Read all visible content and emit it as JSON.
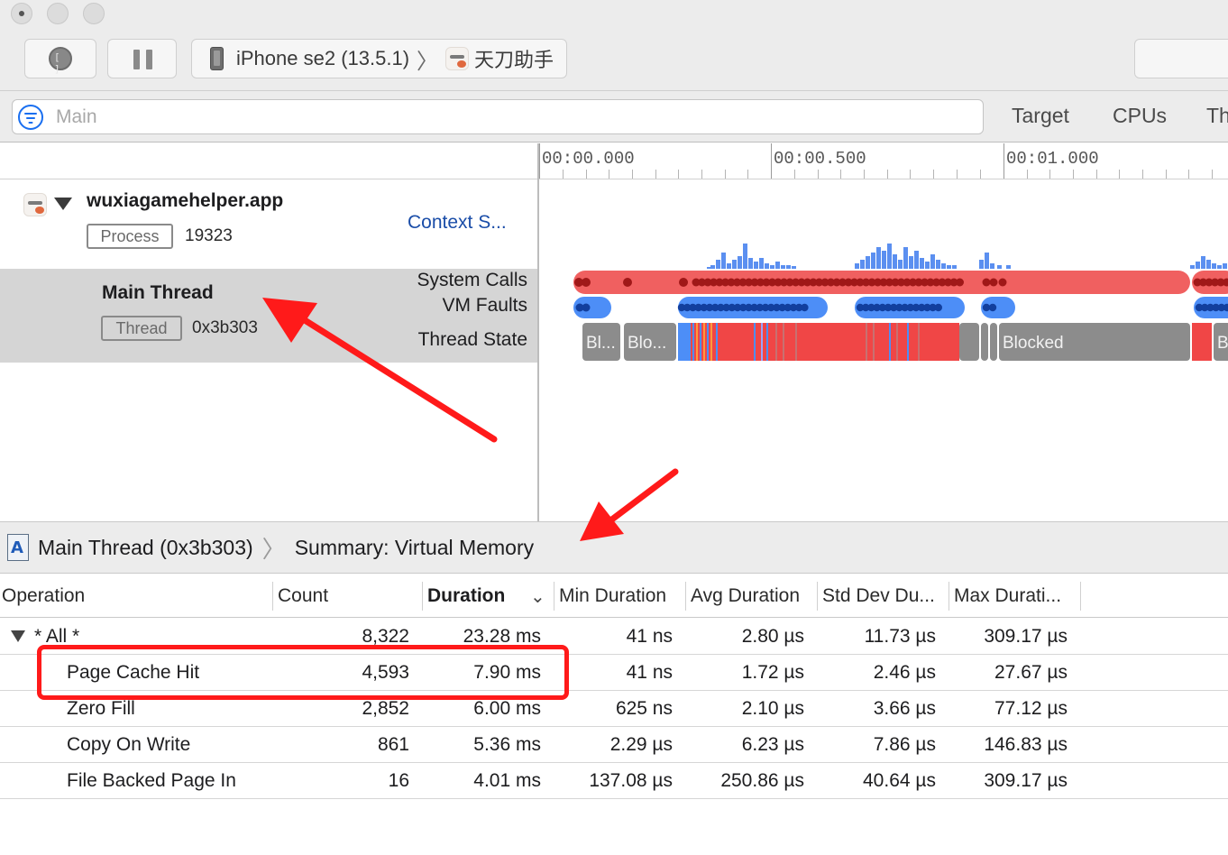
{
  "window": {
    "device_name": "iPhone se2 (13.5.1)",
    "app_name": "天刀助手"
  },
  "filter": {
    "placeholder": "Main",
    "value": "",
    "scope_tabs": [
      "Target",
      "CPUs",
      "Th"
    ]
  },
  "timeline": {
    "ruler_labels": [
      "00:00.000",
      "00:00.500",
      "00:01.000"
    ],
    "process": {
      "name": "wuxiagamehelper.app",
      "tag": "Process",
      "pid": "19323",
      "lane_label": "Context S..."
    },
    "thread": {
      "name": "Main Thread",
      "tag": "Thread",
      "tid": "0x3b303",
      "lanes": [
        "System Calls",
        "VM Faults",
        "Thread State"
      ],
      "state_labels": [
        "Bl...",
        "Blo...",
        "Blocked",
        "B"
      ]
    },
    "colors": {
      "syscall": "#f06060",
      "syscall_dot": "#a01818",
      "vmfault": "#4d8ef7",
      "vmfault_dot": "#123f9e",
      "blocked": "#8c8c8c",
      "running": "#f04646",
      "activity": "#5b8ff0"
    }
  },
  "detail": {
    "breadcrumb": [
      "Main Thread (0x3b303)",
      "Summary: Virtual Memory"
    ],
    "columns": [
      "Operation",
      "Count",
      "Duration",
      "Min Duration",
      "Avg Duration",
      "Std Dev Du...",
      "Max Durati..."
    ],
    "sorted_column": "Duration",
    "rows": [
      {
        "op": "* All *",
        "count": "8,322",
        "duration": "23.28 ms",
        "min": "41 ns",
        "avg": "2.80 µs",
        "std": "11.73 µs",
        "max": "309.17 µs",
        "expandable": true
      },
      {
        "op": "Page Cache Hit",
        "count": "4,593",
        "duration": "7.90 ms",
        "min": "41 ns",
        "avg": "1.72 µs",
        "std": "2.46 µs",
        "max": "27.67 µs"
      },
      {
        "op": "Zero Fill",
        "count": "2,852",
        "duration": "6.00 ms",
        "min": "625 ns",
        "avg": "2.10 µs",
        "std": "3.66 µs",
        "max": "77.12 µs"
      },
      {
        "op": "Copy On Write",
        "count": "861",
        "duration": "5.36 ms",
        "min": "2.29 µs",
        "avg": "6.23 µs",
        "std": "7.86 µs",
        "max": "146.83 µs"
      },
      {
        "op": "File Backed Page In",
        "count": "16",
        "duration": "4.01 ms",
        "min": "137.08 µs",
        "avg": "250.86 µs",
        "std": "40.64 µs",
        "max": "309.17 µs"
      }
    ]
  },
  "annotations": {
    "color": "#ff1a1a"
  }
}
